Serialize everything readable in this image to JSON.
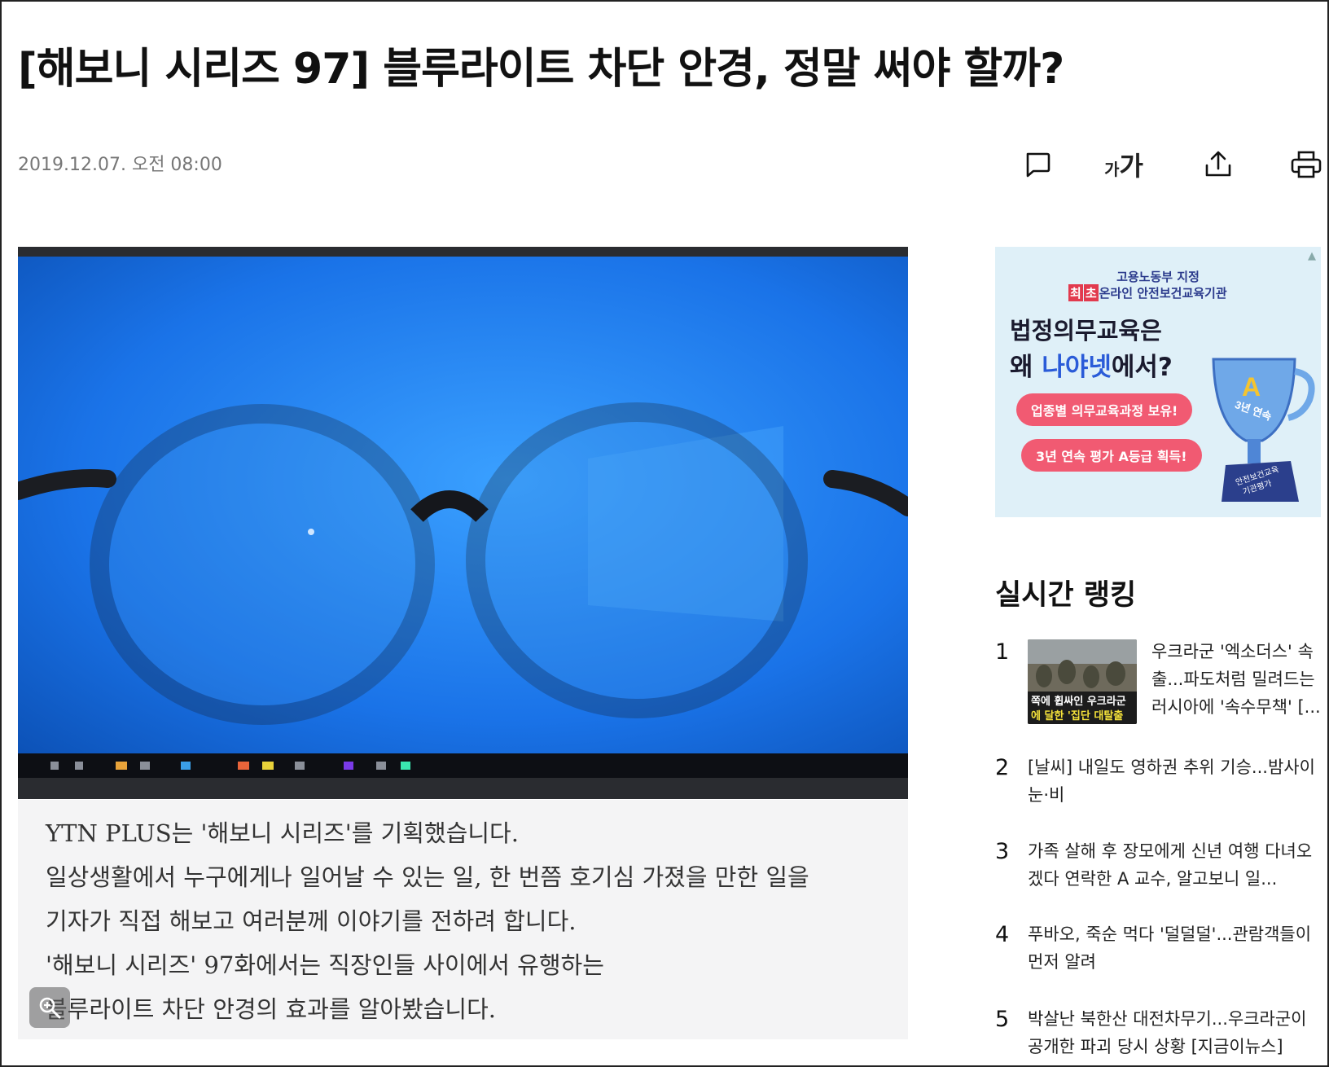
{
  "article": {
    "title": "[해보니 시리즈 97] 블루라이트 차단 안경, 정말 써야 할까?",
    "date": "2019.12.07. 오전 08:00"
  },
  "toolbar": {
    "font_small": "가",
    "font_large": "가",
    "icons": [
      "comment-icon",
      "font-size-icon",
      "share-icon",
      "print-icon"
    ]
  },
  "image": {
    "caption_lines": [
      "YTN PLUS는 '해보니 시리즈'를 기획했습니다.",
      "일상생활에서 누구에게나 일어날 수 있는 일, 한 번쯤 호기심 가졌을 만한 일을",
      "기자가 직접 해보고 여러분께 이야기를 전하려 합니다.",
      "'해보니 시리즈' 97화에서는 직장인들 사이에서 유행하는",
      "블루라이트 차단 안경의 효과를 알아봤습니다."
    ]
  },
  "ad": {
    "line1": "고용노동부 지정",
    "tag1": "최",
    "tag2": "초",
    "line2": "온라인 안전보건교육기관",
    "headline1": "법정의무교육은",
    "headline2_pre": "왜 ",
    "headline2_brand": "나야넷",
    "headline2_post": "에서?",
    "pill1": "업종별 의무교육과정 보유!",
    "pill2": "3년 연속 평가 A등급 획득!",
    "trophy_grade": "A",
    "trophy_sub": "3년 연속",
    "trophy_base1": "안전보건교육",
    "trophy_base2": "기관평가"
  },
  "ranking": {
    "title": "실시간 랭킹",
    "items": [
      {
        "rank": "1",
        "text": "우크라군 '엑소더스' 속출...파도처럼 밀려드는 러시아에 '속수무책' [...",
        "thumb_caption1": "쪽에 휩싸인 우크라군",
        "thumb_caption2": "에 달한 '집단 대탈출"
      },
      {
        "rank": "2",
        "text": "[날씨] 내일도 영하권 추위 기승...밤사이 눈·비"
      },
      {
        "rank": "3",
        "text": "가족 살해 후 장모에게 신년 여행 다녀오겠다 연락한 A 교수, 알고보니 일..."
      },
      {
        "rank": "4",
        "text": "푸바오, 죽순 먹다 '덜덜덜'...관람객들이 먼저 알려"
      },
      {
        "rank": "5",
        "text": "박살난 북한산 대전차무기...우크라군이 공개한 파괴 당시 상황 [지금이뉴스]"
      }
    ]
  },
  "colors": {
    "screen_blue": "#1a73e8",
    "ad_background": "#dff0f8",
    "ad_pill": "#f15a72",
    "ad_brand": "#2a5bd8"
  }
}
